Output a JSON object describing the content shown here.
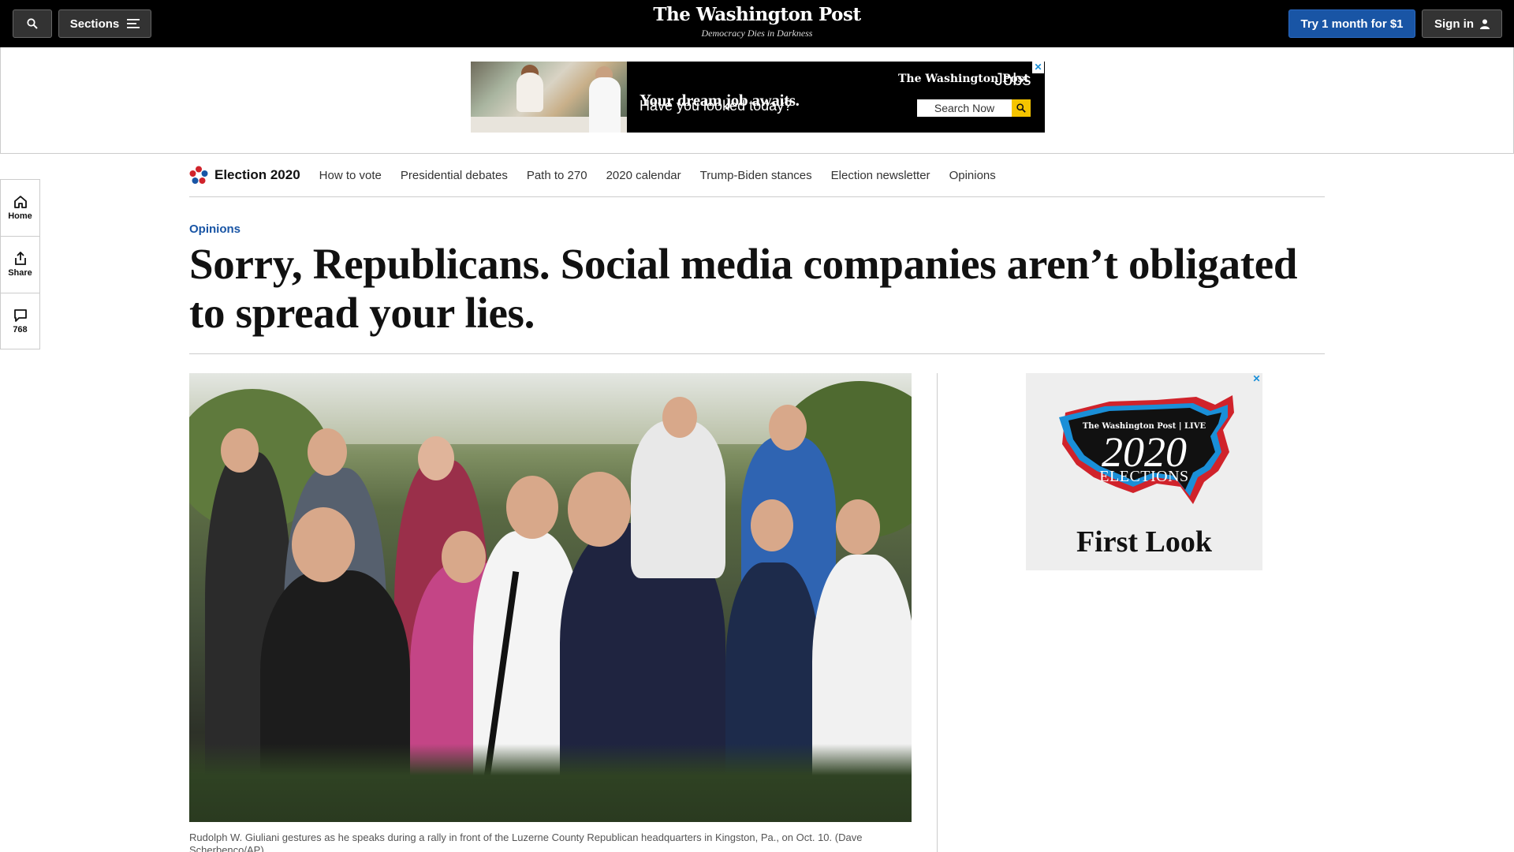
{
  "header": {
    "sections_label": "Sections",
    "logo": "The Washington Post",
    "tagline": "Democracy Dies in Darkness",
    "subscribe_label": "Try 1 month for $1",
    "signin_label": "Sign in",
    "background_color": "#000000",
    "subscribe_color": "#1955a5"
  },
  "top_ad": {
    "headline": "Your dream job awaits.",
    "subhead": "Have you looked today?",
    "brand": "The Washington Post",
    "brand_suffix": "Jobs",
    "search_label": "Search Now",
    "close_label": "✕"
  },
  "election_nav": {
    "title": "Election 2020",
    "links": [
      "How to vote",
      "Presidential debates",
      "Path to 270",
      "2020 calendar",
      "Trump-Biden stances",
      "Election newsletter",
      "Opinions"
    ]
  },
  "rail": {
    "home_label": "Home",
    "share_label": "Share",
    "comment_count": "768"
  },
  "article": {
    "kicker": "Opinions",
    "headline": "Sorry, Republicans. Social media companies aren’t obligated to spread your lies.",
    "caption": "Rudolph W. Giuliani gestures as he speaks during a rally in front of the Luzerne County Republican headquarters in Kingston, Pa., on Oct. 10. (Dave Scherbenco/AP)",
    "kicker_color": "#1955a5"
  },
  "side_ad": {
    "brand": "The Washington Post | LIVE",
    "year": "2020",
    "label": "ELECTIONS",
    "tagline": "First Look",
    "close_label": "✕"
  }
}
